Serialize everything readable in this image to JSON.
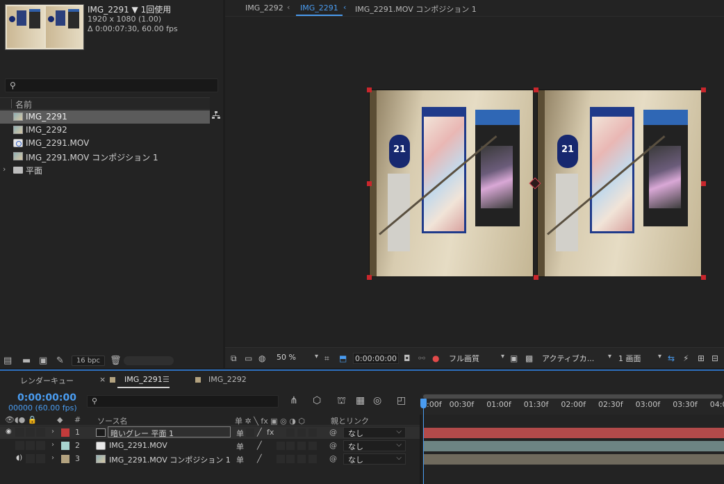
{
  "project": {
    "item_title": "IMG_2291 ▼ 1回使用",
    "info_size": "1920 x 1080 (1.00)",
    "info_duration": "Δ 0:00:07:30, 60.00 fps",
    "search_placeholder": "",
    "column_name": "名前",
    "items": [
      {
        "label": "IMG_2291",
        "type": "comp",
        "selected": true
      },
      {
        "label": "IMG_2292",
        "type": "comp",
        "selected": false
      },
      {
        "label": "IMG_2291.MOV",
        "type": "mov",
        "selected": false
      },
      {
        "label": "IMG_2291.MOV コンポジション 1",
        "type": "comp",
        "selected": false
      },
      {
        "label": "平面",
        "type": "folder",
        "selected": false
      }
    ],
    "bpc": "16 bpc"
  },
  "viewer": {
    "tabs": [
      "IMG_2292",
      "IMG_2291",
      "IMG_2291.MOV コンポジション 1"
    ],
    "active_tab": "IMG_2291",
    "frame_label": "21",
    "zoom": "50 %",
    "time": "0:00:00:00",
    "quality": "フル画質",
    "camera": "アクティブカ...",
    "views": "1 画面"
  },
  "timeline": {
    "tabs": [
      "レンダーキュー",
      "IMG_2291",
      "IMG_2292"
    ],
    "close_glyph": "×",
    "menu_glyph": "☰",
    "timecode": "0:00:00:00",
    "fps": "00000 (60.00 fps)",
    "ruler": [
      "0:00f",
      "00:30f",
      "01:00f",
      "01:30f",
      "02:00f",
      "02:30f",
      "03:00f",
      "03:30f",
      "04:0"
    ],
    "header_hash": "#",
    "header_source": "ソース名",
    "header_switches": "单 ✲ ╲ fx ▣ ◎ ◑ ⬡",
    "header_parent": "親とリンク",
    "layers": [
      {
        "num": "1",
        "name": "暗いグレー 平面 1",
        "color": "#c33b3b",
        "parent": "なし",
        "bar": "#b24a4a"
      },
      {
        "num": "2",
        "name": "IMG_2291.MOV",
        "color": "#a8d4cf",
        "parent": "なし",
        "bar": "#6d8483"
      },
      {
        "num": "3",
        "name": "IMG_2291.MOV コンポジション 1",
        "color": "#b3a27f",
        "parent": "なし",
        "bar": "#6f6a5d"
      }
    ]
  },
  "colors": {
    "accent": "#4a9cf0",
    "handle": "#c9262c",
    "panel_bg": "#232323"
  }
}
